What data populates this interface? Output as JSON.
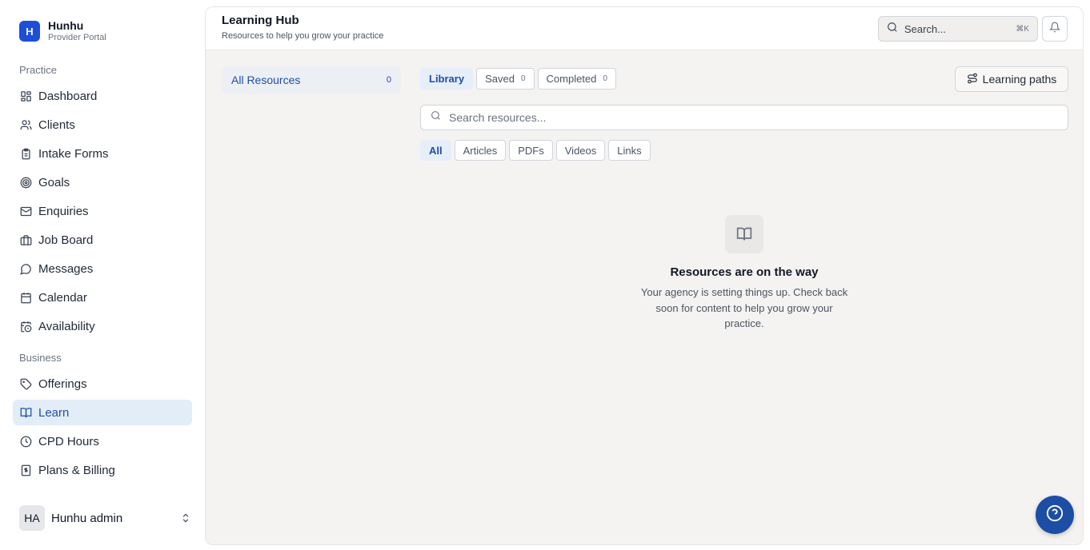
{
  "brand": {
    "logo_letter": "H",
    "name": "Hunhu",
    "subtitle": "Provider Portal"
  },
  "sidebar": {
    "sections": [
      {
        "label": "Practice",
        "items": [
          {
            "label": "Dashboard",
            "icon": "dashboard-icon"
          },
          {
            "label": "Clients",
            "icon": "users-icon"
          },
          {
            "label": "Intake Forms",
            "icon": "clipboard-icon"
          },
          {
            "label": "Goals",
            "icon": "target-icon"
          },
          {
            "label": "Enquiries",
            "icon": "mail-icon"
          },
          {
            "label": "Job Board",
            "icon": "briefcase-icon"
          },
          {
            "label": "Messages",
            "icon": "chat-icon"
          },
          {
            "label": "Calendar",
            "icon": "calendar-icon"
          },
          {
            "label": "Availability",
            "icon": "calendar-clock-icon"
          }
        ]
      },
      {
        "label": "Business",
        "items": [
          {
            "label": "Offerings",
            "icon": "tag-icon"
          },
          {
            "label": "Learn",
            "icon": "book-open-icon",
            "active": true
          },
          {
            "label": "CPD Hours",
            "icon": "clock-icon"
          },
          {
            "label": "Plans & Billing",
            "icon": "receipt-icon"
          }
        ]
      }
    ],
    "user": {
      "initials": "HA",
      "name": "Hunhu admin"
    }
  },
  "header": {
    "title": "Learning Hub",
    "subtitle": "Resources to help you grow your practice",
    "search_label": "Search...",
    "search_shortcut": "⌘K"
  },
  "categories": {
    "label": "All Resources",
    "count": "0"
  },
  "tabs": [
    {
      "label": "Library",
      "active": true
    },
    {
      "label": "Saved",
      "count": "0"
    },
    {
      "label": "Completed",
      "count": "0"
    }
  ],
  "learning_paths_label": "Learning paths",
  "resource_search": {
    "placeholder": "Search resources...",
    "value": ""
  },
  "filters": [
    {
      "label": "All",
      "active": true
    },
    {
      "label": "Articles"
    },
    {
      "label": "PDFs"
    },
    {
      "label": "Videos"
    },
    {
      "label": "Links"
    }
  ],
  "empty_state": {
    "title": "Resources are on the way",
    "description": "Your agency is setting things up. Check back soon for content to help you grow your practice."
  },
  "colors": {
    "accent": "#1d4ea6",
    "active_bg": "#e3edf8",
    "panel_bg": "#f4f3f1"
  }
}
